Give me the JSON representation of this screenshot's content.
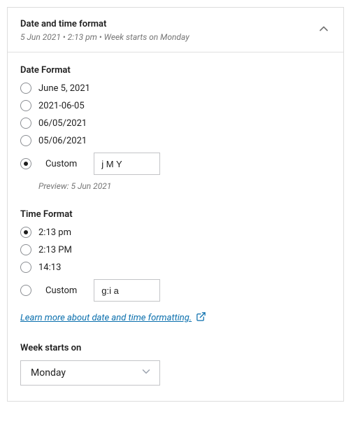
{
  "header": {
    "title": "Date and time format",
    "subtitle": "5 Jun 2021 • 2:13 pm • Week starts on Monday"
  },
  "dateFormat": {
    "label": "Date Format",
    "options": [
      "June 5, 2021",
      "2021-06-05",
      "06/05/2021",
      "05/06/2021"
    ],
    "customLabel": "Custom",
    "customValue": "j M Y",
    "customSelected": true,
    "previewPrefix": "Preview: ",
    "previewValue": "5 Jun 2021"
  },
  "timeFormat": {
    "label": "Time Format",
    "options": [
      "2:13 pm",
      "2:13 PM",
      "14:13"
    ],
    "selectedIndex": 0,
    "customLabel": "Custom",
    "customValue": "g:i a",
    "customSelected": false
  },
  "link": {
    "text": "Learn more about date and time formatting."
  },
  "weekStart": {
    "label": "Week starts on",
    "value": "Monday"
  }
}
